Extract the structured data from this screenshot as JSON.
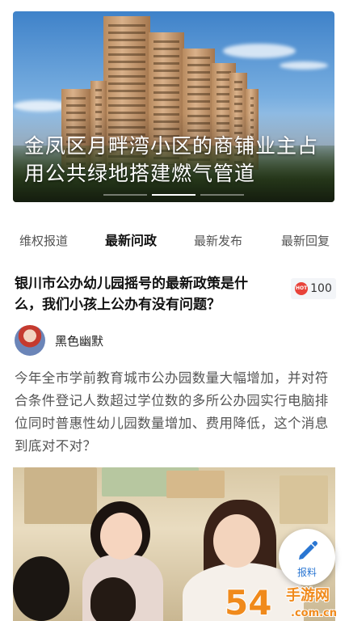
{
  "banner": {
    "title": "金凤区月畔湾小区的商铺业主占用公共绿地搭建燃气管道",
    "slide_count": 3,
    "active_slide": 1
  },
  "tabs": [
    {
      "label": "维权报道",
      "active": false
    },
    {
      "label": "最新问政",
      "active": true
    },
    {
      "label": "最新发布",
      "active": false
    },
    {
      "label": "最新回复",
      "active": false
    }
  ],
  "article": {
    "title": "银川市公办幼儿园摇号的最新政策是什么，我们小孩上公办有没有问题？",
    "hot_badge_text": "HOT",
    "hot_count": "100",
    "author_name": "黑色幽默",
    "body": "今年全市学前教育城市公办园数量大幅增加，并对符合条件登记人数超过学位数的多所公办园实行电脑排位同时普惠性幼儿园数量增加、费用降低，这个消息到底对不对？"
  },
  "fab": {
    "label": "报料",
    "icon": "pencil-icon",
    "color": "#2a76d2"
  },
  "watermark": {
    "text_main": "54",
    "text_side": "手游网",
    "text_domain": ".com.cn",
    "color": "#f08a1c"
  },
  "colors": {
    "hot_badge": "#e8433a",
    "active_tab": "#111111"
  }
}
